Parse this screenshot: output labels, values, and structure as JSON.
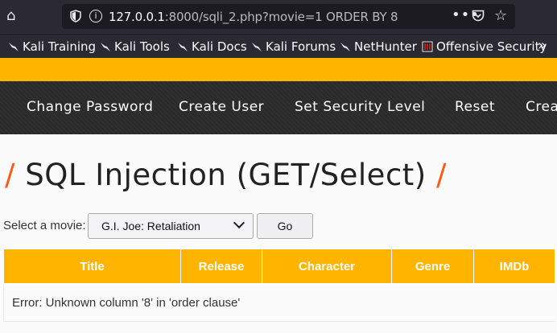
{
  "browser": {
    "url_host": "127.0.0.1",
    "url_rest": ":8000/sqli_2.php?movie=1 ORDER BY 8",
    "more_label": "•••",
    "bookmarks": [
      {
        "label": "Kali Training"
      },
      {
        "label": "Kali Tools"
      },
      {
        "label": "Kali Docs"
      },
      {
        "label": "Kali Forums"
      },
      {
        "label": "NetHunter"
      },
      {
        "label": "Offensive Security"
      }
    ],
    "overflow_label": "»"
  },
  "menu": {
    "items": [
      "Change Password",
      "Create User",
      "Set Security Level",
      "Reset",
      "Crea"
    ]
  },
  "page": {
    "title": "SQL Injection (GET/Select)",
    "title_slash": "/",
    "select_label": "Select a movie:",
    "selected_movie": "G.I. Joe: Retaliation",
    "go_label": "Go"
  },
  "table": {
    "headers": [
      "Title",
      "Release",
      "Character",
      "Genre",
      "IMDb"
    ],
    "error": "Error: Unknown column '8' in 'order clause'"
  },
  "colors": {
    "accent": "#ffb400",
    "title_slash": "#ff5c1a",
    "menu_bg": "#2a2a2a",
    "chrome_bg": "#2b2a33"
  }
}
